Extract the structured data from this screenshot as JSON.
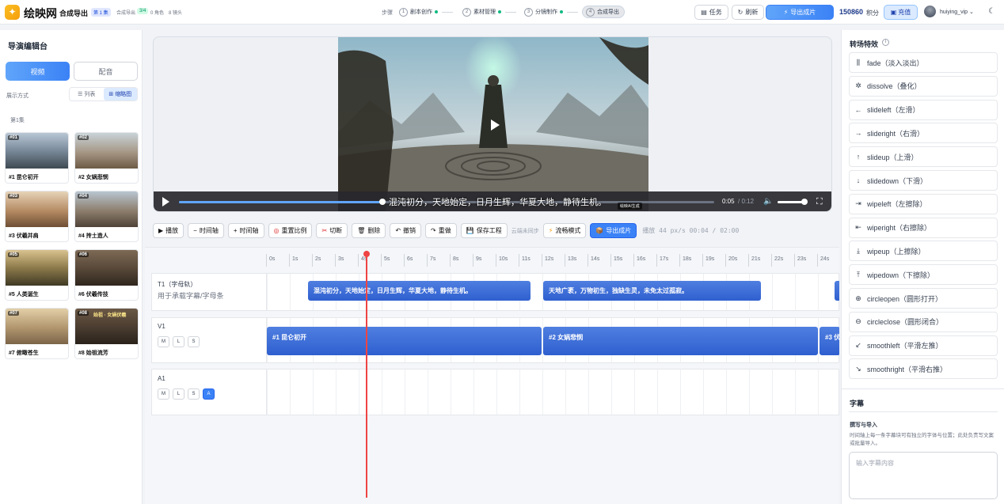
{
  "header": {
    "brand": "绘映网",
    "page_title": "合成导出",
    "episode_badge": "第 1 集",
    "tag_export": "合成导出",
    "tag_step": "3/4",
    "tag_roles": "0 角色",
    "tag_shots": "8 镜头",
    "steps_label": "步骤",
    "steps": [
      {
        "num": "1",
        "label": "剧本创作"
      },
      {
        "num": "2",
        "label": "素材管理"
      },
      {
        "num": "3",
        "label": "分镜制作"
      },
      {
        "num": "4",
        "label": "合成导出"
      }
    ],
    "task_label": "任务",
    "refresh_label": "刷新",
    "export_label": "导出成片",
    "points": "150860",
    "points_unit": "积分",
    "charge_label": "充值",
    "username": "huiying_vip"
  },
  "left": {
    "title": "导演编辑台",
    "tab_video": "视频",
    "tab_dub": "配音",
    "display_label": "展示方式",
    "view_list": "列表",
    "view_thumb": "缩略图",
    "episode": "第1集",
    "shots": [
      {
        "code": "#01",
        "name": "#1 昆仑初开"
      },
      {
        "code": "#02",
        "name": "#2 女娲悲悯"
      },
      {
        "code": "#03",
        "name": "#3 伏羲并肩"
      },
      {
        "code": "#04",
        "name": "#4 抟土造人"
      },
      {
        "code": "#05",
        "name": "#5 人类诞生"
      },
      {
        "code": "#06",
        "name": "#6 伏羲传技"
      },
      {
        "code": "#07",
        "name": "#7 俯瞰苍生"
      },
      {
        "code": "#08",
        "name": "#8 始祖流芳"
      }
    ],
    "shot8_overlay": "始祖 · 女娲伏羲"
  },
  "player": {
    "subtitle": "混沌初分，天地始定，日月生辉，华夏大地，静待生机。",
    "ai_tag": "绘映AI生成",
    "time_now": "0:05",
    "time_total": "/ 0:12",
    "progress": 0.38,
    "volume": 0.9
  },
  "toolbar": {
    "play": "播放",
    "minus_axis": "时间轴",
    "plus_axis": "时间轴",
    "reset_ratio": "重置比例",
    "cut": "切断",
    "delete": "删除",
    "undo": "撤销",
    "redo": "重做",
    "save": "保存工程",
    "cloud_note": "云端未同步",
    "smooth_mode": "流畅模式",
    "export": "导出成片",
    "status": "播放 44 px/s 00:04 / 02:00"
  },
  "timeline": {
    "ticks": [
      "0s",
      "1s",
      "2s",
      "3s",
      "4s",
      "5s",
      "6s",
      "7s",
      "8s",
      "9s",
      "10s",
      "11s",
      "12s",
      "13s",
      "14s",
      "15s",
      "16s",
      "17s",
      "18s",
      "19s",
      "20s",
      "21s",
      "22s",
      "23s",
      "24s"
    ],
    "track_t1_name": "T1（字母轨）",
    "track_t1_hint": "用于承载字幕/字母条",
    "track_v1_name": "V1",
    "track_a1_name": "A1",
    "btn_m": "M",
    "btn_l": "L",
    "btn_s": "S",
    "btn_a": "A",
    "subtitle_clips": [
      "混沌初分，天地始定，日月生辉，华夏大地，静待生机。",
      "天地广袤，万物初生，独缺生灵，未免太过孤寂。"
    ],
    "video_clips": [
      "#1 昆仑初开",
      "#2 女娲悲悯",
      "#3 伏"
    ]
  },
  "right": {
    "title": "转场特效",
    "transitions": [
      {
        "icon": "bars-icon",
        "glyph": "⫼",
        "label": "fade（淡入淡出）"
      },
      {
        "icon": "asterisk-icon",
        "glyph": "✲",
        "label": "dissolve（叠化）"
      },
      {
        "icon": "arrow-left-icon",
        "glyph": "←",
        "label": "slideleft（左滑）"
      },
      {
        "icon": "arrow-right-icon",
        "glyph": "→",
        "label": "slideright（右滑）"
      },
      {
        "icon": "arrow-up-icon",
        "glyph": "↑",
        "label": "slideup（上滑）"
      },
      {
        "icon": "arrow-down-icon",
        "glyph": "↓",
        "label": "slidedown（下滑）"
      },
      {
        "icon": "wipe-left-icon",
        "glyph": "⇥",
        "label": "wipeleft（左擦除）"
      },
      {
        "icon": "wipe-right-icon",
        "glyph": "⇤",
        "label": "wiperight（右擦除）"
      },
      {
        "icon": "wipe-up-icon",
        "glyph": "⤓",
        "label": "wipeup（上擦除）"
      },
      {
        "icon": "wipe-down-icon",
        "glyph": "⤒",
        "label": "wipedown（下擦除）"
      },
      {
        "icon": "circle-plus-icon",
        "glyph": "⊕",
        "label": "circleopen（圆形打开）"
      },
      {
        "icon": "circle-minus-icon",
        "glyph": "⊖",
        "label": "circleclose（圆形闭合）"
      },
      {
        "icon": "curve-left-icon",
        "glyph": "↙",
        "label": "smoothleft（平滑左推）"
      },
      {
        "icon": "curve-right-icon",
        "glyph": "↘",
        "label": "smoothright（平滑右推）"
      }
    ],
    "subtitle_title": "字幕",
    "import_title": "撰写与导入",
    "import_desc": "时间轴上每一条字幕块可有独立的字体与位置；此处负责写文案或批量导入。",
    "input_placeholder": "输入字幕内容"
  }
}
